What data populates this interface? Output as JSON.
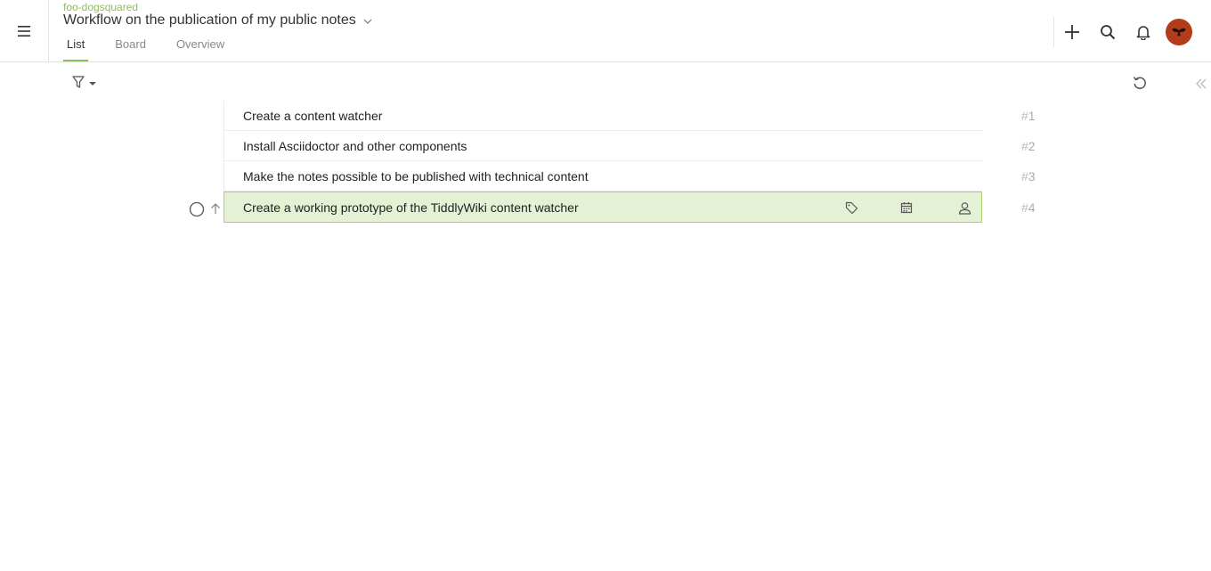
{
  "header": {
    "org": "foo-dogsquared",
    "project": "Workflow on the publication of my public notes",
    "tabs": [
      {
        "label": "List",
        "active": true
      },
      {
        "label": "Board",
        "active": false
      },
      {
        "label": "Overview",
        "active": false
      }
    ],
    "tools": [
      "plus-icon",
      "search-icon",
      "bell-icon",
      "avatar"
    ]
  },
  "colors": {
    "accent": "#8fbd5a",
    "selected_bg": "#e5f1d5",
    "selected_border": "#a9d072",
    "avatar": "#b23c1c"
  },
  "tasks": [
    {
      "title": "Create a content watcher",
      "hash": "#",
      "num": "1"
    },
    {
      "title": "Install Asciidoctor and other components",
      "hash": "#",
      "num": "2"
    },
    {
      "title": "Make the notes possible to be published with technical content",
      "hash": "#",
      "num": "3"
    },
    {
      "title": "Create a working prototype of the TiddlyWiki content watcher",
      "hash": "#",
      "num": "4",
      "selected": true
    }
  ]
}
